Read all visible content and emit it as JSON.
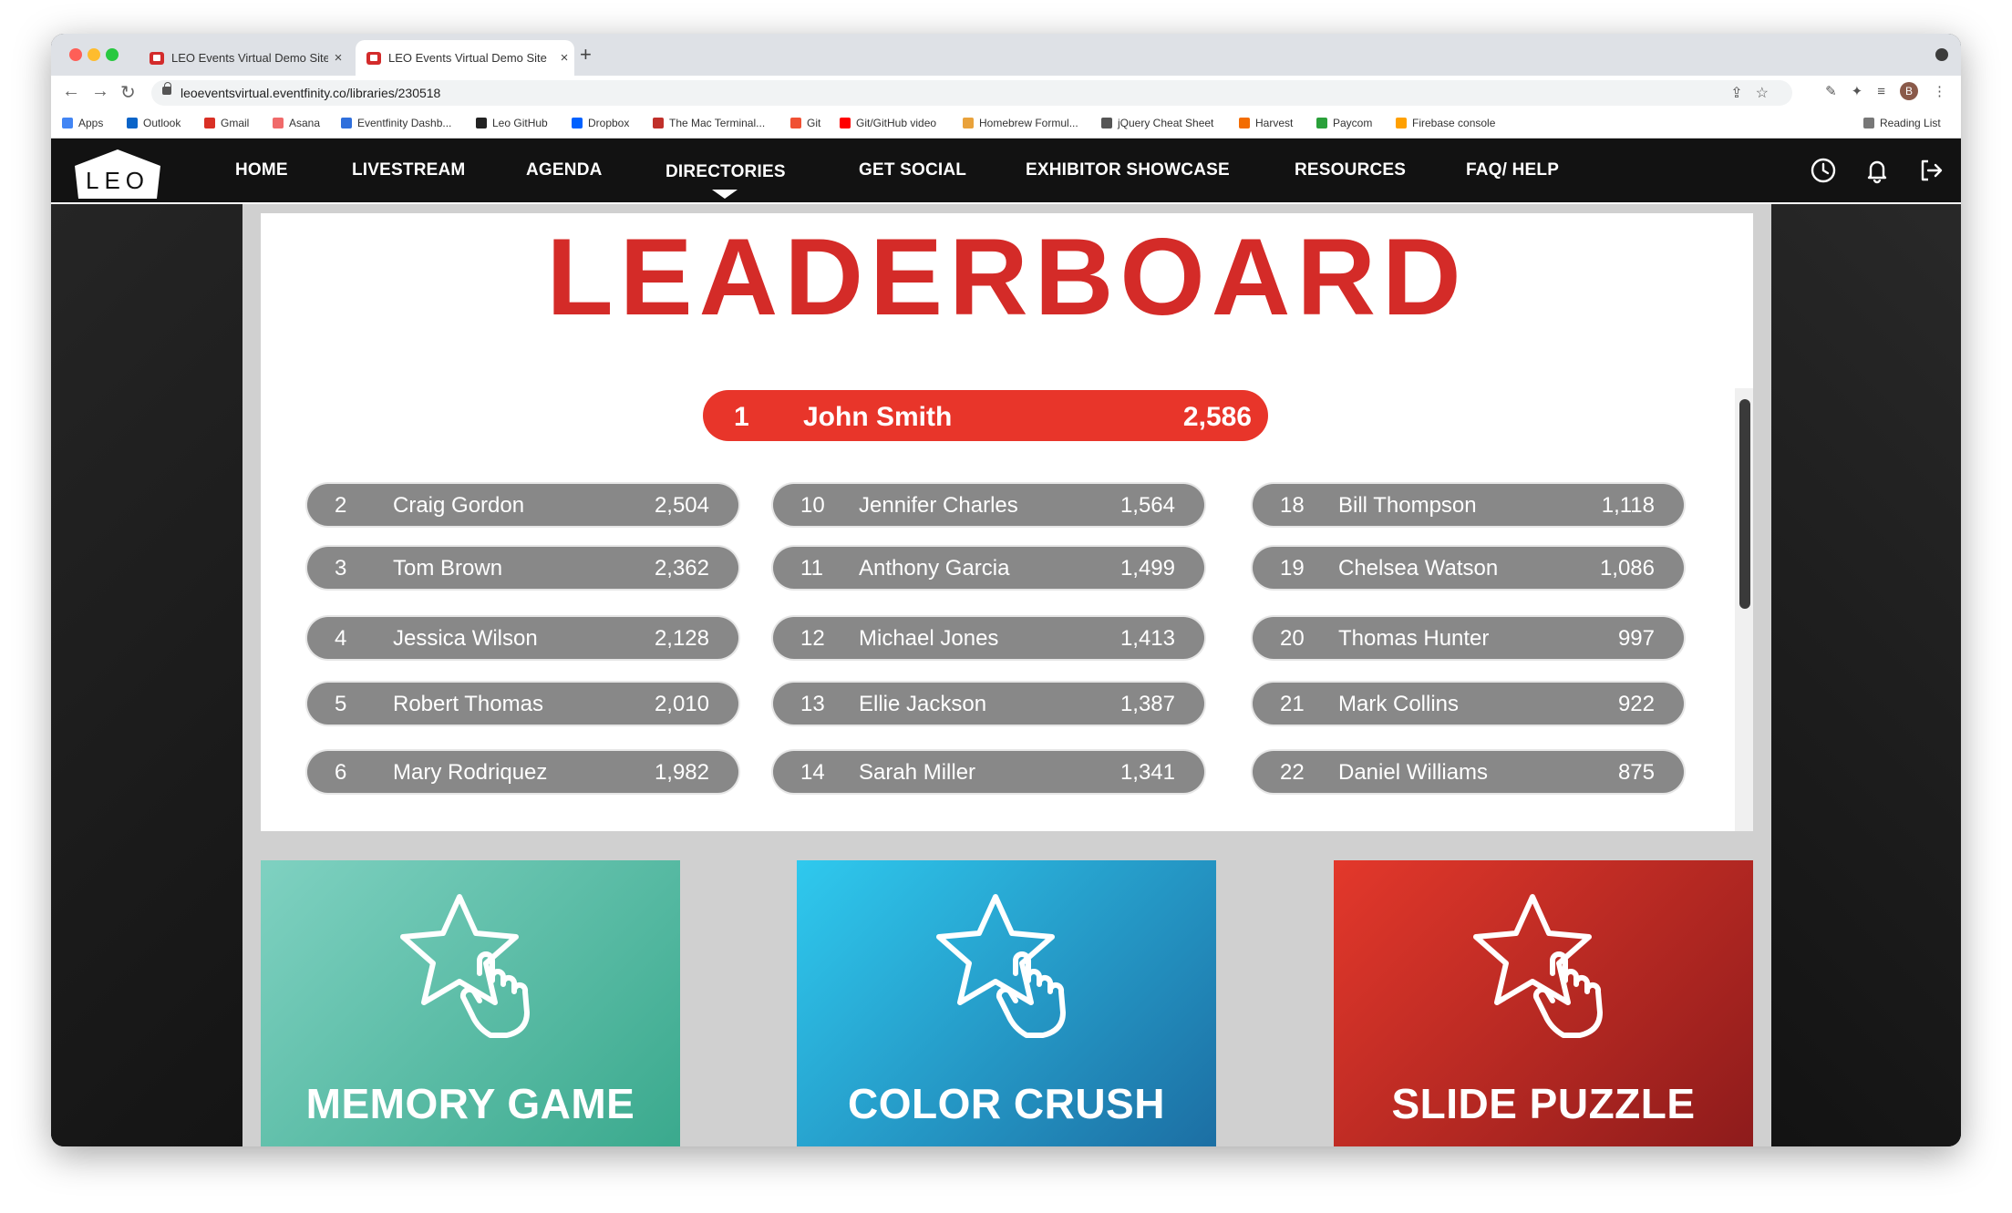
{
  "browser": {
    "tabs": [
      {
        "title": "LEO Events Virtual Demo Site"
      },
      {
        "title": "LEO Events Virtual Demo Site"
      }
    ],
    "url": "leoeventsvirtual.eventfinity.co/libraries/230518",
    "avatar_initial": "B",
    "bookmarks": [
      {
        "label": "Apps",
        "color": "#4285f4"
      },
      {
        "label": "Outlook",
        "color": "#0a64c8"
      },
      {
        "label": "Gmail",
        "color": "#d93025"
      },
      {
        "label": "Asana",
        "color": "#f06a6a"
      },
      {
        "label": "Eventfinity Dashb...",
        "color": "#2f6fdc"
      },
      {
        "label": "Leo GitHub",
        "color": "#222222"
      },
      {
        "label": "Dropbox",
        "color": "#0061ff"
      },
      {
        "label": "The Mac Terminal...",
        "color": "#c0302a"
      },
      {
        "label": "Git",
        "color": "#f05033"
      },
      {
        "label": "Git/GitHub video",
        "color": "#ff0000"
      },
      {
        "label": "Homebrew Formul...",
        "color": "#e9a23b"
      },
      {
        "label": "jQuery Cheat Sheet",
        "color": "#555555"
      },
      {
        "label": "Harvest",
        "color": "#f36c00"
      },
      {
        "label": "Paycom",
        "color": "#2aa03a"
      },
      {
        "label": "Firebase console",
        "color": "#ffa000"
      }
    ],
    "reading_list": "Reading List"
  },
  "site": {
    "logo_text": "LEO",
    "nav": [
      {
        "label": "HOME"
      },
      {
        "label": "LIVESTREAM"
      },
      {
        "label": "AGENDA"
      },
      {
        "label": "DIRECTORIES"
      },
      {
        "label": "GET SOCIAL"
      },
      {
        "label": "EXHIBITOR SHOWCASE"
      },
      {
        "label": "RESOURCES"
      },
      {
        "label": "FAQ/ HELP"
      }
    ],
    "nav_icons": [
      "clock-icon",
      "bell-icon",
      "logout-icon"
    ]
  },
  "leaderboard": {
    "title": "LEADERBOARD",
    "first": {
      "rank": "1",
      "name": "John Smith",
      "score": "2,586"
    },
    "columns": [
      [
        {
          "rank": "2",
          "name": "Craig Gordon",
          "score": "2,504"
        },
        {
          "rank": "3",
          "name": "Tom Brown",
          "score": "2,362"
        },
        {
          "rank": "4",
          "name": "Jessica Wilson",
          "score": "2,128"
        },
        {
          "rank": "5",
          "name": "Robert Thomas",
          "score": "2,010"
        },
        {
          "rank": "6",
          "name": "Mary Rodriquez",
          "score": "1,982"
        }
      ],
      [
        {
          "rank": "10",
          "name": "Jennifer Charles",
          "score": "1,564"
        },
        {
          "rank": "11",
          "name": "Anthony Garcia",
          "score": "1,499"
        },
        {
          "rank": "12",
          "name": "Michael Jones",
          "score": "1,413"
        },
        {
          "rank": "13",
          "name": "Ellie Jackson",
          "score": "1,387"
        },
        {
          "rank": "14",
          "name": "Sarah Miller",
          "score": "1,341"
        }
      ],
      [
        {
          "rank": "18",
          "name": "Bill Thompson",
          "score": "1,118"
        },
        {
          "rank": "19",
          "name": "Chelsea Watson",
          "score": "1,086"
        },
        {
          "rank": "20",
          "name": "Thomas Hunter",
          "score": "997"
        },
        {
          "rank": "21",
          "name": "Mark Collins",
          "score": "922"
        },
        {
          "rank": "22",
          "name": "Daniel Williams",
          "score": "875"
        }
      ]
    ]
  },
  "games": [
    {
      "label": "MEMORY GAME",
      "color_from": "#7fd1c1",
      "color_to": "#3aa98d"
    },
    {
      "label": "COLOR CRUSH",
      "color_from": "#2fc9ee",
      "color_to": "#1c6ea3"
    },
    {
      "label": "SLIDE PUZZLE",
      "color_from": "#e3382b",
      "color_to": "#8d1b1b"
    }
  ],
  "colors": {
    "accent_red": "#d42b28",
    "row_gray": "#888888",
    "first_red": "#e8352a"
  }
}
